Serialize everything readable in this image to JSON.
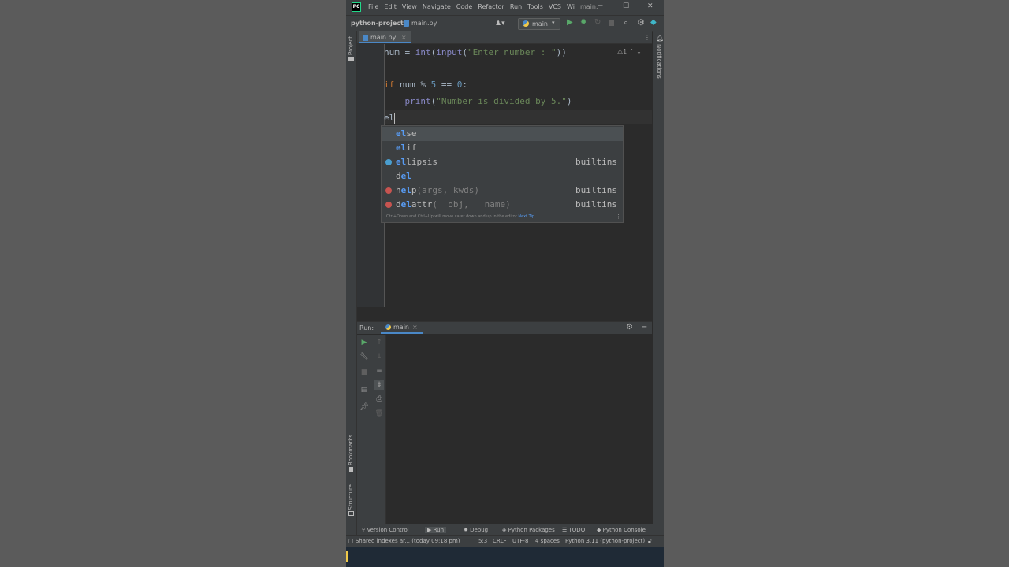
{
  "title_bar": {
    "menu": [
      "File",
      "Edit",
      "View",
      "Navigate",
      "Code",
      "Refactor",
      "Run",
      "Tools",
      "VCS",
      "Wi",
      "main."
    ],
    "minimize": "─",
    "maximize": "☐",
    "close": "✕"
  },
  "nav_bar": {
    "project": "python-project",
    "file": "main.py",
    "run_config": "main"
  },
  "left_strip": {
    "project": "Project",
    "bookmarks": "Bookmarks",
    "structure": "Structure"
  },
  "right_strip": {
    "notifications": "Notifications"
  },
  "editor": {
    "tab_label": "main.py",
    "inspection_count": "1",
    "lines": {
      "l1": {
        "a": "num = ",
        "b": "int",
        "c": "(",
        "d": "input",
        "e": "(",
        "f": "\"Enter number : \"",
        "g": "))"
      },
      "l3": {
        "kw": "if",
        "a": " num % ",
        "n1": "5",
        "b": " == ",
        "n2": "0",
        "c": ":"
      },
      "l4": {
        "indent": "    ",
        "fn": "print",
        "a": "(",
        "s": "\"Number is divided by 5.\"",
        "b": ")"
      },
      "l5": {
        "typed": "el"
      }
    }
  },
  "completion": {
    "items": [
      {
        "hl": "el",
        "rest": "se",
        "params": "",
        "source": ""
      },
      {
        "hl": "el",
        "rest": "if",
        "params": "",
        "source": ""
      },
      {
        "hl": "el",
        "rest": "lipsis",
        "params": "",
        "source": "builtins"
      },
      {
        "pre": "d",
        "hl": "el",
        "rest": "",
        "params": "",
        "source": ""
      },
      {
        "pre": "h",
        "hl": "el",
        "rest": "p",
        "params": "(args, kwds)",
        "source": "builtins"
      },
      {
        "pre": "d",
        "hl": "el",
        "rest": "attr",
        "params": "(__obj, __name)",
        "source": "builtins"
      }
    ],
    "tip": "Ctrl+Down and Ctrl+Up will move caret down and up in the editor",
    "tip_link": "Next Tip",
    "colors": {
      "ellipsis": "#4a9ecf",
      "function": "#c75450"
    }
  },
  "run_panel": {
    "label": "Run:",
    "tab": "main"
  },
  "bottom_tabs": [
    "Version Control",
    "Run",
    "Debug",
    "Python Packages",
    "TODO",
    "Python Console"
  ],
  "status_bar": {
    "message": "Shared indexes ar... (today 09:18 pm)",
    "position": "5:3",
    "line_sep": "CRLF",
    "encoding": "UTF-8",
    "indent": "4 spaces",
    "interpreter": "Python 3.11 (python-project)"
  }
}
